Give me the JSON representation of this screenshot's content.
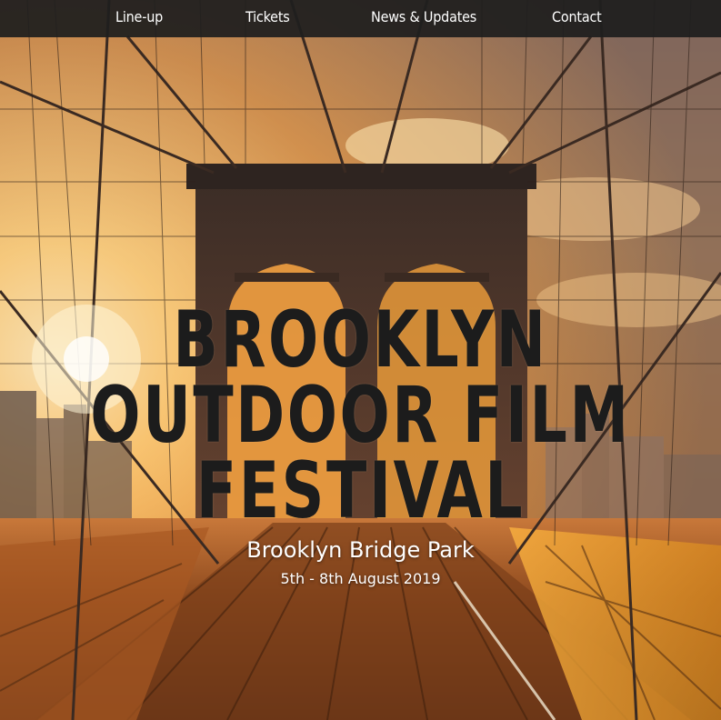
{
  "nav": {
    "items": [
      {
        "label": "Line-up"
      },
      {
        "label": "Tickets"
      },
      {
        "label": "News & Updates"
      },
      {
        "label": "Contact"
      }
    ]
  },
  "hero": {
    "title_lines": [
      "BROOKLYN",
      "OUTDOOR FILM",
      "FESTIVAL"
    ],
    "venue": "Brooklyn Bridge Park",
    "dates": "5th - 8th August 2019"
  },
  "colors": {
    "nav_bg": "#1e1e1e",
    "title": "#1c1c1c",
    "subtitle": "#ffffff",
    "sky_glow": "#ffd58a",
    "deck": "#a8541c"
  }
}
